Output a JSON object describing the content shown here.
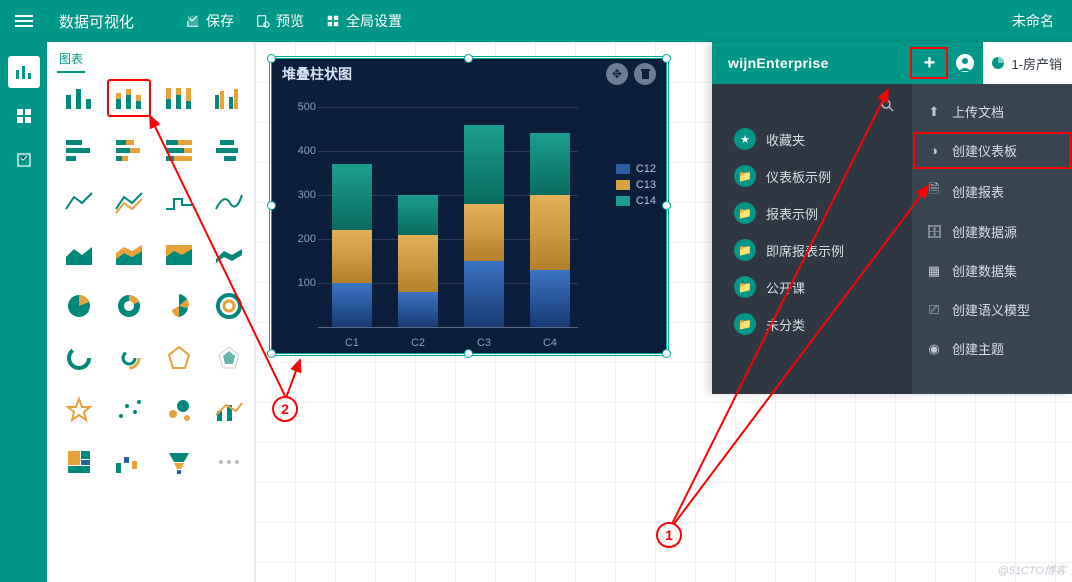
{
  "topbar": {
    "title": "数据可视化",
    "save": "保存",
    "preview": "预览",
    "global": "全局设置",
    "docname": "未命名"
  },
  "sidepanel": {
    "tab": "图表"
  },
  "widget": {
    "title": "堆叠柱状图",
    "yticks": [
      "500",
      "400",
      "300",
      "200",
      "100"
    ],
    "xcats": [
      "C1",
      "C2",
      "C3",
      "C4"
    ],
    "legend": [
      "C12",
      "C13",
      "C14"
    ]
  },
  "chart_data": {
    "type": "bar",
    "subtype": "stacked",
    "title": "堆叠柱状图",
    "xlabel": "",
    "ylabel": "",
    "ylim": [
      0,
      500
    ],
    "categories": [
      "C1",
      "C2",
      "C3",
      "C4"
    ],
    "series": [
      {
        "name": "C12",
        "color": "#2b5fa3",
        "values": [
          100,
          80,
          150,
          130
        ]
      },
      {
        "name": "C13",
        "color": "#d6a23d",
        "values": [
          120,
          130,
          130,
          170
        ]
      },
      {
        "name": "C14",
        "color": "#1a9e8f",
        "values": [
          150,
          90,
          180,
          140
        ]
      }
    ]
  },
  "overlay": {
    "brand": "wijnEnterprise",
    "tab_label": "1-房产销",
    "left_items": [
      "收藏夹",
      "仪表板示例",
      "报表示例",
      "即席报表示例",
      "公开课",
      "未分类"
    ],
    "menu": [
      "上传文档",
      "创建仪表板",
      "创建报表",
      "创建数据源",
      "创建数据集",
      "创建语义模型",
      "创建主题"
    ]
  },
  "annotations": {
    "one": "1",
    "two": "2"
  },
  "watermark": "@51CTO博客"
}
